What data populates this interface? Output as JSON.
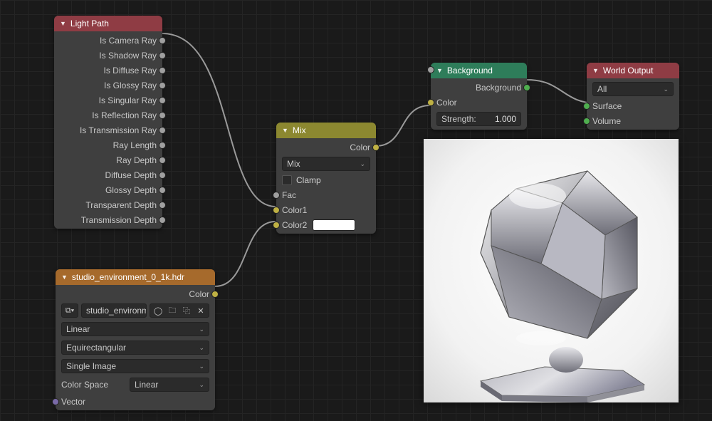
{
  "lightPath": {
    "title": "Light Path",
    "outputs": [
      "Is Camera Ray",
      "Is Shadow Ray",
      "Is Diffuse Ray",
      "Is Glossy Ray",
      "Is Singular Ray",
      "Is Reflection Ray",
      "Is Transmission Ray",
      "Ray Length",
      "Ray Depth",
      "Diffuse Depth",
      "Glossy Depth",
      "Transparent Depth",
      "Transmission Depth"
    ]
  },
  "envTex": {
    "title": "studio_environment_0_1k.hdr",
    "outputColor": "Color",
    "fileName": "studio_environment..",
    "interp": "Linear",
    "projection": "Equirectangular",
    "source": "Single Image",
    "colorSpaceLabel": "Color Space",
    "colorSpace": "Linear",
    "vector": "Vector"
  },
  "mix": {
    "title": "Mix",
    "outputColor": "Color",
    "blendMode": "Mix",
    "clamp": "Clamp",
    "fac": "Fac",
    "color1": "Color1",
    "color2": "Color2"
  },
  "background": {
    "title": "Background",
    "output": "Background",
    "color": "Color",
    "strengthLabel": "Strength:",
    "strengthValue": "1.000"
  },
  "worldOutput": {
    "title": "World Output",
    "target": "All",
    "surface": "Surface",
    "volume": "Volume"
  },
  "icons": {
    "tri": "▼",
    "chev": "⌄",
    "imageData": "⧉▾",
    "shield": "◯",
    "folder": "🗀",
    "duplicate": "⿻",
    "close": "✕"
  }
}
